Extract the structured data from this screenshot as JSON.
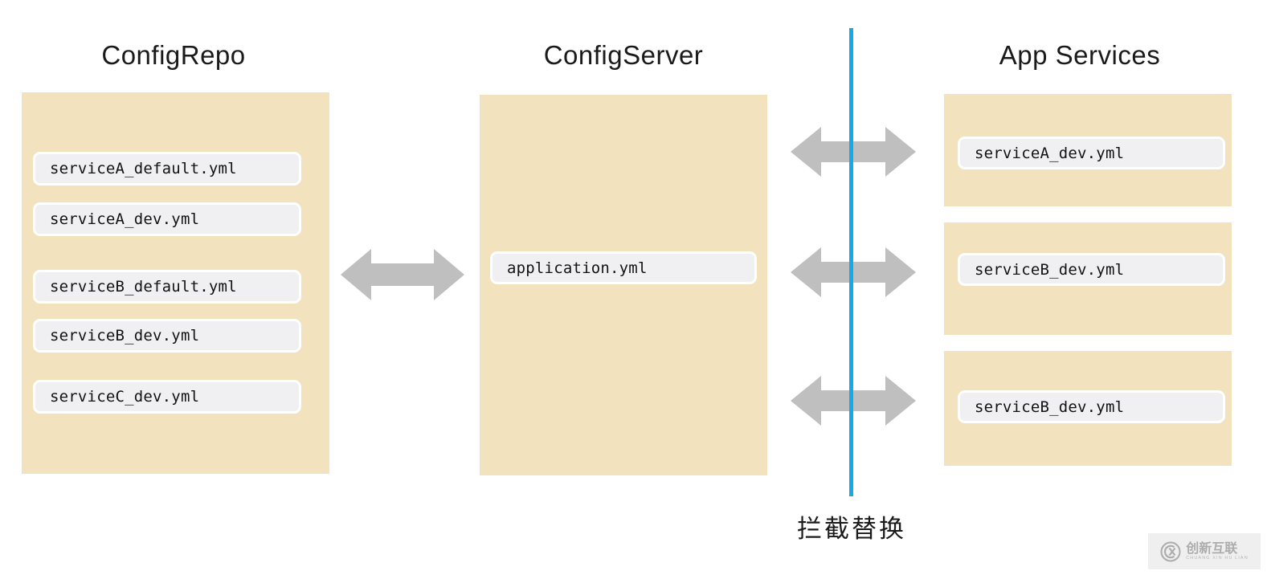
{
  "diagram": {
    "title_repo": "ConfigRepo",
    "title_server": "ConfigServer",
    "title_apps": "App Services",
    "caption_intercept": "拦截替换",
    "colors": {
      "panel_beige": "#F2E3BE",
      "chip_gray": "#F0F0F2",
      "arrow_gray": "#BFBFBF",
      "intercept_blue": "#18A8E8",
      "text_black": "#121212",
      "page_background": "#FFFFFF"
    }
  },
  "config_repo": {
    "files": [
      "serviceA_default.yml",
      "serviceA_dev.yml",
      "serviceB_default.yml",
      "serviceB_dev.yml",
      "serviceC_dev.yml"
    ]
  },
  "config_server": {
    "files": [
      "application.yml"
    ]
  },
  "app_services": {
    "services": [
      "serviceA_dev.yml",
      "serviceB_dev.yml",
      "serviceB_dev.yml"
    ]
  },
  "arrows": [
    {
      "name": "repo-to-server",
      "direction": "bidirectional"
    },
    {
      "name": "server-to-appA",
      "direction": "bidirectional"
    },
    {
      "name": "server-to-appB",
      "direction": "bidirectional"
    },
    {
      "name": "server-to-appC",
      "direction": "bidirectional"
    }
  ],
  "watermark": {
    "cn": "创新互联",
    "pinyin": "CHUANG XIN HU LIAN"
  }
}
